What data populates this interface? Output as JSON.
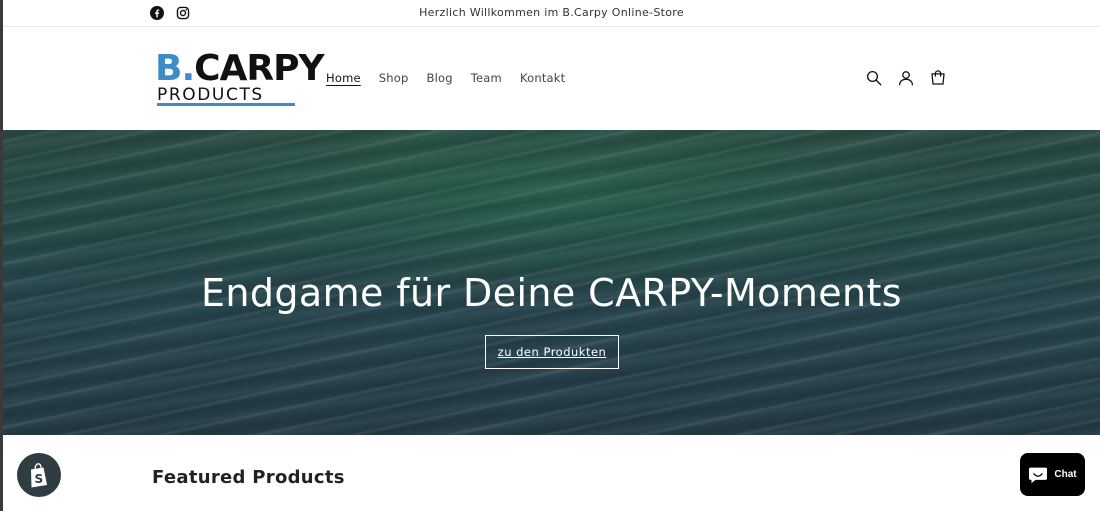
{
  "announcement": {
    "text": "Herzlich Willkommen im B.Carpy Online-Store",
    "social_icons": [
      "facebook-icon",
      "instagram-icon"
    ]
  },
  "logo": {
    "line1_accent": "B.",
    "line1_rest": "CARPY",
    "line2": "PRODUCTS",
    "accent_color": "#3e8cc7"
  },
  "nav": {
    "items": [
      {
        "label": "Home",
        "active": true
      },
      {
        "label": "Shop",
        "active": false
      },
      {
        "label": "Blog",
        "active": false
      },
      {
        "label": "Team",
        "active": false
      },
      {
        "label": "Kontakt",
        "active": false
      }
    ]
  },
  "header_icons": [
    "search-icon",
    "account-icon",
    "cart-icon"
  ],
  "hero": {
    "title": "Endgame für Deine CARPY-Moments",
    "button_label": "zu den Produkten"
  },
  "featured": {
    "title": "Featured Products"
  },
  "chat": {
    "label": "Chat"
  },
  "colors": {
    "chat_bg": "#000000",
    "badge_bg": "#2f3c42"
  }
}
